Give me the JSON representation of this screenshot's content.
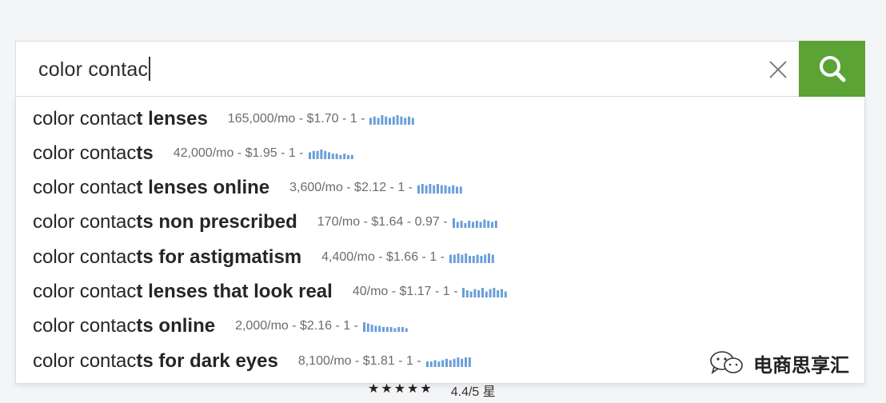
{
  "search": {
    "query": "color contac"
  },
  "suggestions": [
    {
      "typed": "color contac",
      "completion": "t lenses",
      "meta": "165,000/mo - $1.70 - 1 -",
      "trend": [
        5,
        6,
        5,
        7,
        6,
        5,
        6,
        7,
        6,
        5,
        6,
        5
      ]
    },
    {
      "typed": "color contac",
      "completion": "ts",
      "meta": "42,000/mo - $1.95 - 1 -",
      "trend": [
        5,
        6,
        6,
        7,
        6,
        5,
        4,
        4,
        3,
        4,
        3,
        3
      ]
    },
    {
      "typed": "color contac",
      "completion": "t lenses online",
      "meta": "3,600/mo - $2.12 - 1 -",
      "trend": [
        6,
        7,
        6,
        7,
        6,
        7,
        6,
        6,
        5,
        6,
        5,
        5
      ]
    },
    {
      "typed": "color contac",
      "completion": "ts non prescribed",
      "meta": "170/mo - $1.64 - 0.97 -",
      "trend": [
        8,
        5,
        6,
        4,
        6,
        5,
        6,
        5,
        7,
        6,
        5,
        6
      ]
    },
    {
      "typed": "color contac",
      "completion": "ts for astigmatism",
      "meta": "4,400/mo - $1.66 - 1 -",
      "trend": [
        7,
        7,
        8,
        7,
        8,
        6,
        6,
        7,
        6,
        7,
        8,
        7
      ]
    },
    {
      "typed": "color contac",
      "completion": "t lenses that look real",
      "meta": "40/mo - $1.17 - 1 -",
      "trend": [
        8,
        6,
        5,
        7,
        6,
        8,
        5,
        7,
        8,
        6,
        7,
        5
      ]
    },
    {
      "typed": "color contac",
      "completion": "ts online",
      "meta": "2,000/mo - $2.16 - 1 -",
      "trend": [
        8,
        7,
        6,
        5,
        5,
        4,
        4,
        4,
        3,
        4,
        4,
        3
      ]
    },
    {
      "typed": "color contac",
      "completion": "ts for dark eyes",
      "meta": "8,100/mo - $1.81 - 1 -",
      "trend": [
        4,
        4,
        5,
        4,
        5,
        6,
        5,
        6,
        7,
        6,
        7,
        7
      ]
    }
  ],
  "watermark": {
    "text": "电商思享汇"
  },
  "rating": {
    "stars": "★★★★★",
    "score": "4.4/5 星"
  },
  "colors": {
    "search_button": "#5ba335",
    "sparkline": "#6b9fd8"
  },
  "icons": {
    "clear": "close-icon",
    "search": "search-icon",
    "watermark": "wechat-icon"
  }
}
